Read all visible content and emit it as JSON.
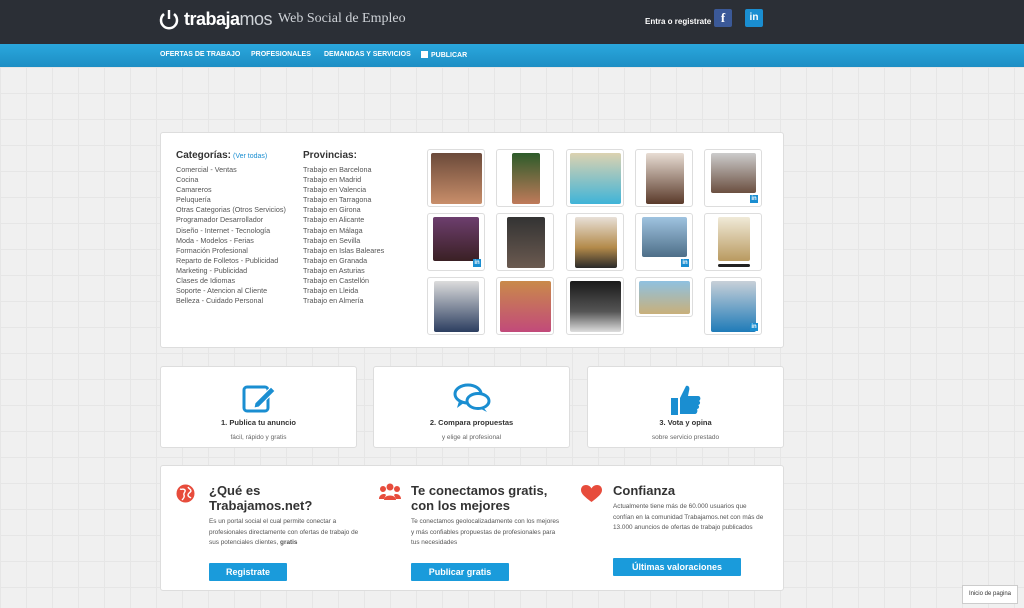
{
  "header": {
    "logo_name_bold": "trabaja",
    "logo_name_thin": "mos",
    "tagline": "Web Social de Empleo",
    "login_label": "Entra o registrate",
    "facebook_glyph": "f",
    "linkedin_glyph": "in"
  },
  "nav": {
    "items": [
      "OFERTAS DE TRABAJO",
      "PROFESIONALES",
      "DEMANDAS Y SERVICIOS",
      "PUBLICAR"
    ]
  },
  "categories": {
    "title": "Categorías:",
    "view_all": "(Ver todas)",
    "items": [
      "Comercial - Ventas",
      "Cocina",
      "Camareros",
      "Peluquería",
      "Otras Categorias (Otros Servicios)",
      "Programador Desarrollador",
      "Diseño - Internet - Tecnología",
      "Moda - Modelos - Ferias",
      "Formación Profesional",
      "Reparto de Folletos - Publicidad",
      "Marketing - Publicidad",
      "Clases de Idiomas",
      "Soporte - Atencion al Cliente",
      "Belleza - Cuidado Personal"
    ]
  },
  "provinces": {
    "title": "Provincias:",
    "items": [
      "Trabajo en Barcelona",
      "Trabajo en Madrid",
      "Trabajo en Valencia",
      "Trabajo en Tarragona",
      "Trabajo en Girona",
      "Trabajo en Alicante",
      "Trabajo en Málaga",
      "Trabajo en Sevilla",
      "Trabajo en Islas Baleares",
      "Trabajo en Granada",
      "Trabajo en Asturias",
      "Trabajo en Castellón",
      "Trabajo en Lleida",
      "Trabajo en Almería"
    ]
  },
  "badges": {
    "linkedin": "in"
  },
  "steps": [
    {
      "title": "1. Publica tu anuncio",
      "subtitle": "fácil, rápido y gratis",
      "icon": "pencil-icon"
    },
    {
      "title": "2. Compara propuestas",
      "subtitle": "y elige al profesional",
      "icon": "chat-bubbles-icon"
    },
    {
      "title": "3. Vota y opina",
      "subtitle": "sobre servicio prestado",
      "icon": "thumbs-up-icon"
    }
  ],
  "info": {
    "what": {
      "title_line1": "¿Qué es",
      "title_line2": "Trabajamos.net?",
      "text": "Es un portal social el cual permite conectar a profesionales directamente con ofertas de trabajo de sus potenciales clientes, ",
      "text_bold": "gratis",
      "button": "Registrate",
      "icon": "globe-icon"
    },
    "connect": {
      "title_line1": "Te conectamos gratis,",
      "title_line2": "con los mejores",
      "text": "Te conectamos geolocalizadamente con los mejores y más confiables propuestas de profesionales para tus necesidades",
      "button": "Publicar gratis",
      "icon": "users-icon"
    },
    "trust": {
      "title": "Confianza",
      "text": "Actualmente tiene más de 60.000 usuarios que confían en la comunidad Trabajamos.net con más de 13.000 anuncios de ofertas de trabajo publicados",
      "button": "Últimas valoraciones",
      "icon": "heart-icon"
    }
  },
  "back_to_top": "Inicio de pagina",
  "colors": {
    "header_bg": "#2b2f36",
    "nav_bg": "#1d8ec4",
    "accent": "#1a9bdb",
    "icon_red": "#e74c3c",
    "icon_blue": "#1a8ed1"
  }
}
